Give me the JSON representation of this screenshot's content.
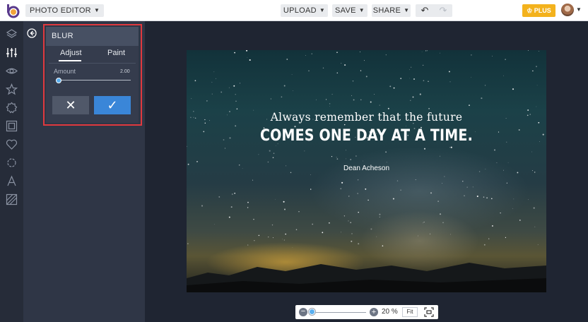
{
  "topbar": {
    "app_menu": "PHOTO EDITOR",
    "upload": "UPLOAD",
    "save": "SAVE",
    "share": "SHARE",
    "plus": "PLUS"
  },
  "panel": {
    "title": "BLUR",
    "tabs": [
      "Adjust",
      "Paint"
    ],
    "active_tab": "Adjust",
    "amount_label": "Amount",
    "amount_value": "2.00",
    "amount_level": 0.0
  },
  "rail_icons": [
    "layers-icon",
    "sliders-icon",
    "eye-icon",
    "star-icon",
    "badge-icon",
    "frame-icon",
    "heart-icon",
    "gear-icon",
    "text-icon",
    "texture-icon"
  ],
  "canvas": {
    "quote_line1": "Always remember that the future",
    "quote_line2": "COMES ONE DAY AT A TIME.",
    "author": "Dean Acheson"
  },
  "zoom": {
    "percent": "20 %",
    "fit": "Fit",
    "level": 0.0
  },
  "colors": {
    "accent_blue": "#3a86d8",
    "plus_gold": "#f3b21d",
    "highlight_red": "#e0393e"
  }
}
